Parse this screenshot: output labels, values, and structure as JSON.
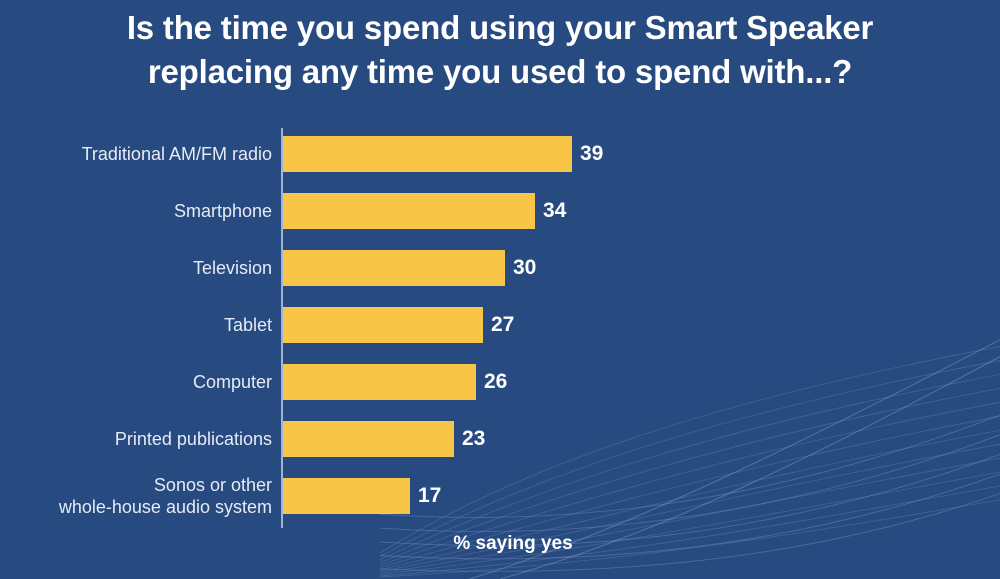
{
  "colors": {
    "background": "#274A80",
    "bar": "#F8C546",
    "title_text": "#FFFFFF",
    "category_text": "#E6EBF4",
    "value_text": "#FFFFFF",
    "axis_line": "#9FB4D4"
  },
  "title": "Is the time you spend using your Smart Speaker\nreplacing any time you used to spend with...?",
  "axis_caption": "% saying yes",
  "chart_data": {
    "type": "bar",
    "orientation": "horizontal",
    "title": "Is the time you spend using your Smart Speaker replacing any time you used to spend with...?",
    "xlabel": "% saying yes",
    "ylabel": "",
    "xlim": [
      0,
      39
    ],
    "grid": false,
    "legend": "none",
    "categories": [
      "Traditional AM/FM radio",
      "Smartphone",
      "Television",
      "Tablet",
      "Computer",
      "Printed publications",
      "Sonos or other\nwhole-house audio system"
    ],
    "values": [
      39,
      34,
      30,
      27,
      26,
      23,
      17
    ],
    "value_labels": [
      "39",
      "34",
      "30",
      "27",
      "26",
      "23",
      "17"
    ],
    "series": [
      {
        "name": "% saying yes",
        "values": [
          39,
          34,
          30,
          27,
          26,
          23,
          17
        ]
      }
    ]
  }
}
